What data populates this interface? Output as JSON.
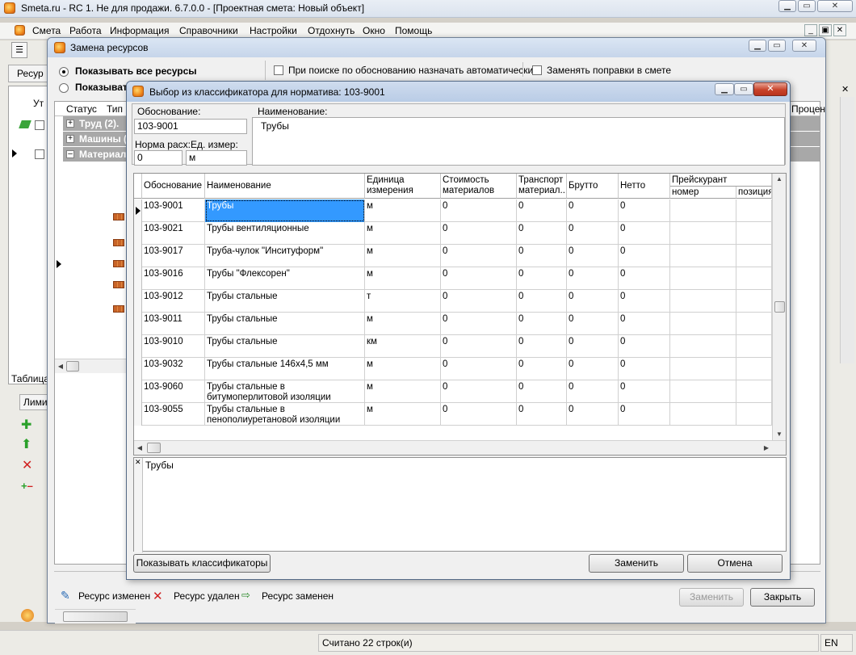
{
  "main_window": {
    "title": "Smeta.ru - RC 1. Не для продажи.  6.7.0.0   - [Проектная смета: Новый объект]",
    "menu": [
      "Смета",
      "Работа",
      "Информация",
      "Справочники",
      "Настройки",
      "Отдохнуть",
      "Окно",
      "Помощь"
    ],
    "status_text": "Считано 22 строк(и)",
    "lang": "EN",
    "left_labels": {
      "resources": "Ресур",
      "util": "Ут",
      "table": "Таблица",
      "limit": "Лими"
    }
  },
  "replace_dialog": {
    "title": "Замена ресурсов",
    "radio_all": "Показывать все ресурсы",
    "radio_other": "Показыват",
    "check_auto": "При поиске по обоснованию назначать автоматически",
    "check_fix": "Заменять поправки в смете",
    "col_status": "Статус",
    "col_type": "Тип",
    "col_percent": "Процен",
    "groups": [
      "Труд (2).",
      "Машины (",
      "Материал"
    ],
    "legend": {
      "changed": "Ресурс изменен",
      "deleted": "Ресурс удален",
      "replaced": "Ресурс заменен"
    },
    "btn_replace": "Заменить",
    "btn_close": "Закрыть"
  },
  "classifier_dialog": {
    "title": "Выбор из классификатора для норматива: 103-9001",
    "basis_label": "Обоснование:",
    "basis_value": "103-9001",
    "name_label": "Наименование:",
    "name_value": "Трубы",
    "norm_label": "Норма расх:",
    "norm_value": "0",
    "unit_label": "Ед. измер:",
    "unit_value": "м",
    "columns": {
      "basis": "Обоснование",
      "name": "Наименование",
      "unit": "Единица измерения",
      "cost": "Стоимость материалов",
      "transport": "Транспорт материал...",
      "gross": "Брутто",
      "net": "Нетто",
      "price_list": "Прейскурант",
      "price_no": "номер",
      "price_pos": "позиция"
    },
    "rows": [
      {
        "basis": "103-9001",
        "name": "Трубы",
        "unit": "м",
        "cost": "0",
        "transport": "0",
        "gross": "0",
        "net": "0"
      },
      {
        "basis": "103-9021",
        "name": "Трубы вентиляционные",
        "unit": "м",
        "cost": "0",
        "transport": "0",
        "gross": "0",
        "net": "0"
      },
      {
        "basis": "103-9017",
        "name": "Труба-чулок \"Инситуформ\"",
        "unit": "м",
        "cost": "0",
        "transport": "0",
        "gross": "0",
        "net": "0"
      },
      {
        "basis": "103-9016",
        "name": "Трубы \"Флексорен\"",
        "unit": "м",
        "cost": "0",
        "transport": "0",
        "gross": "0",
        "net": "0"
      },
      {
        "basis": "103-9012",
        "name": "Трубы стальные",
        "unit": "т",
        "cost": "0",
        "transport": "0",
        "gross": "0",
        "net": "0"
      },
      {
        "basis": "103-9011",
        "name": "Трубы стальные",
        "unit": "м",
        "cost": "0",
        "transport": "0",
        "gross": "0",
        "net": "0"
      },
      {
        "basis": "103-9010",
        "name": "Трубы стальные",
        "unit": "км",
        "cost": "0",
        "transport": "0",
        "gross": "0",
        "net": "0"
      },
      {
        "basis": "103-9032",
        "name": "Трубы стальные 146х4,5 мм",
        "unit": "м",
        "cost": "0",
        "transport": "0",
        "gross": "0",
        "net": "0"
      },
      {
        "basis": "103-9060",
        "name": "Трубы стальные в битумоперлитовой изоляции",
        "unit": "м",
        "cost": "0",
        "transport": "0",
        "gross": "0",
        "net": "0"
      },
      {
        "basis": "103-9055",
        "name": "Трубы стальные в пенополиуретановой изоляции",
        "unit": "м",
        "cost": "0",
        "transport": "0",
        "gross": "0",
        "net": "0"
      }
    ],
    "selected_row": 0,
    "memo_text": "Трубы",
    "btn_show_classifiers": "Показывать классификаторы",
    "btn_replace": "Заменить",
    "btn_cancel": "Отмена"
  }
}
